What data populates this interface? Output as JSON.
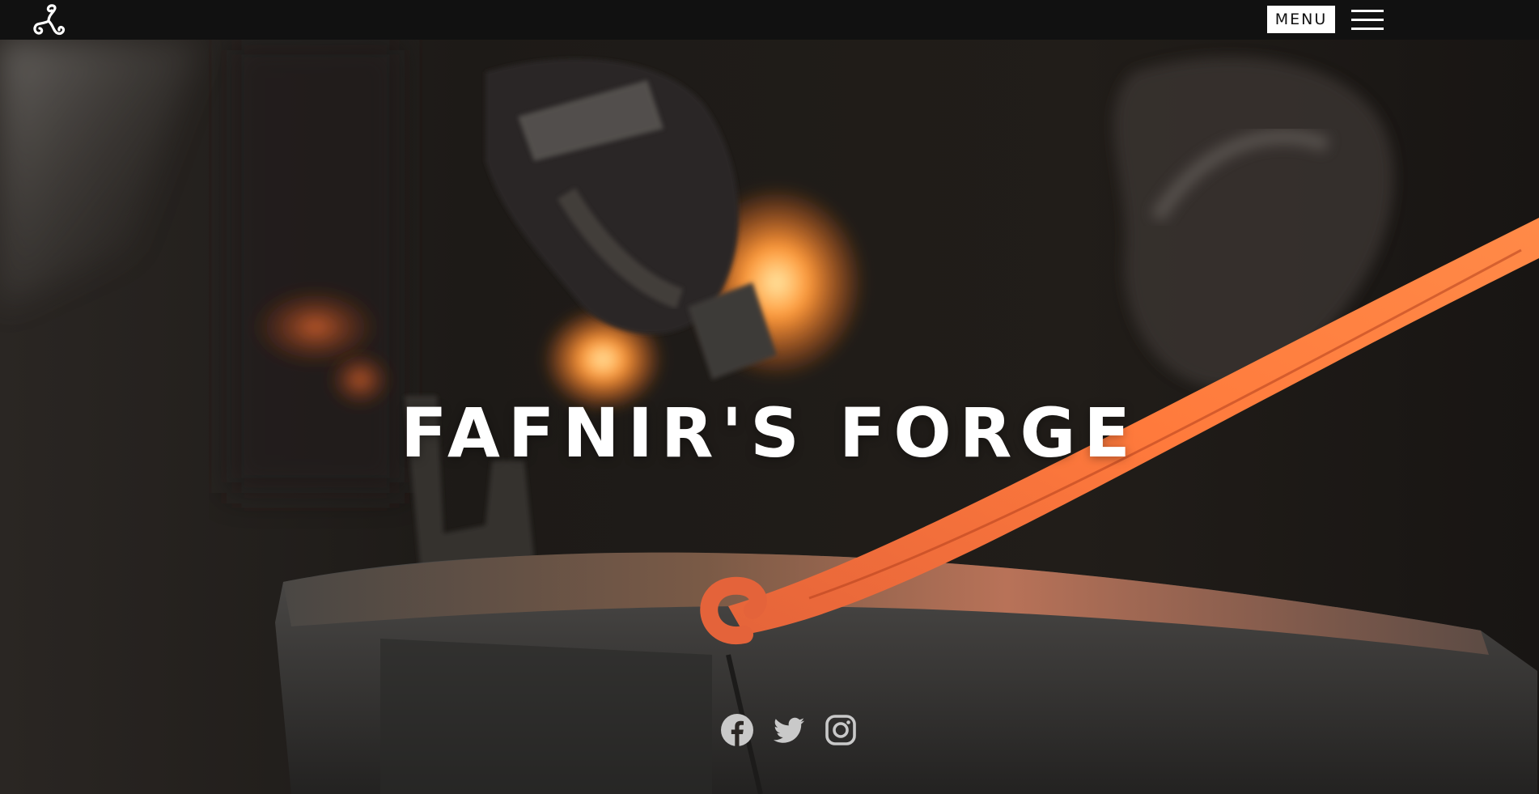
{
  "header": {
    "menu_label": "MENU"
  },
  "hero": {
    "title": "FAFNIR'S FORGE"
  },
  "socials": [
    {
      "name": "facebook",
      "icon": "facebook-icon"
    },
    {
      "name": "twitter",
      "icon": "twitter-icon"
    },
    {
      "name": "instagram",
      "icon": "instagram-icon"
    }
  ],
  "colors": {
    "topbar": "#111111",
    "title": "#ffffff",
    "social_icons": "#c9c9c9",
    "hot_metal": "#ff6a2a",
    "anvil": "#3c3a38"
  }
}
